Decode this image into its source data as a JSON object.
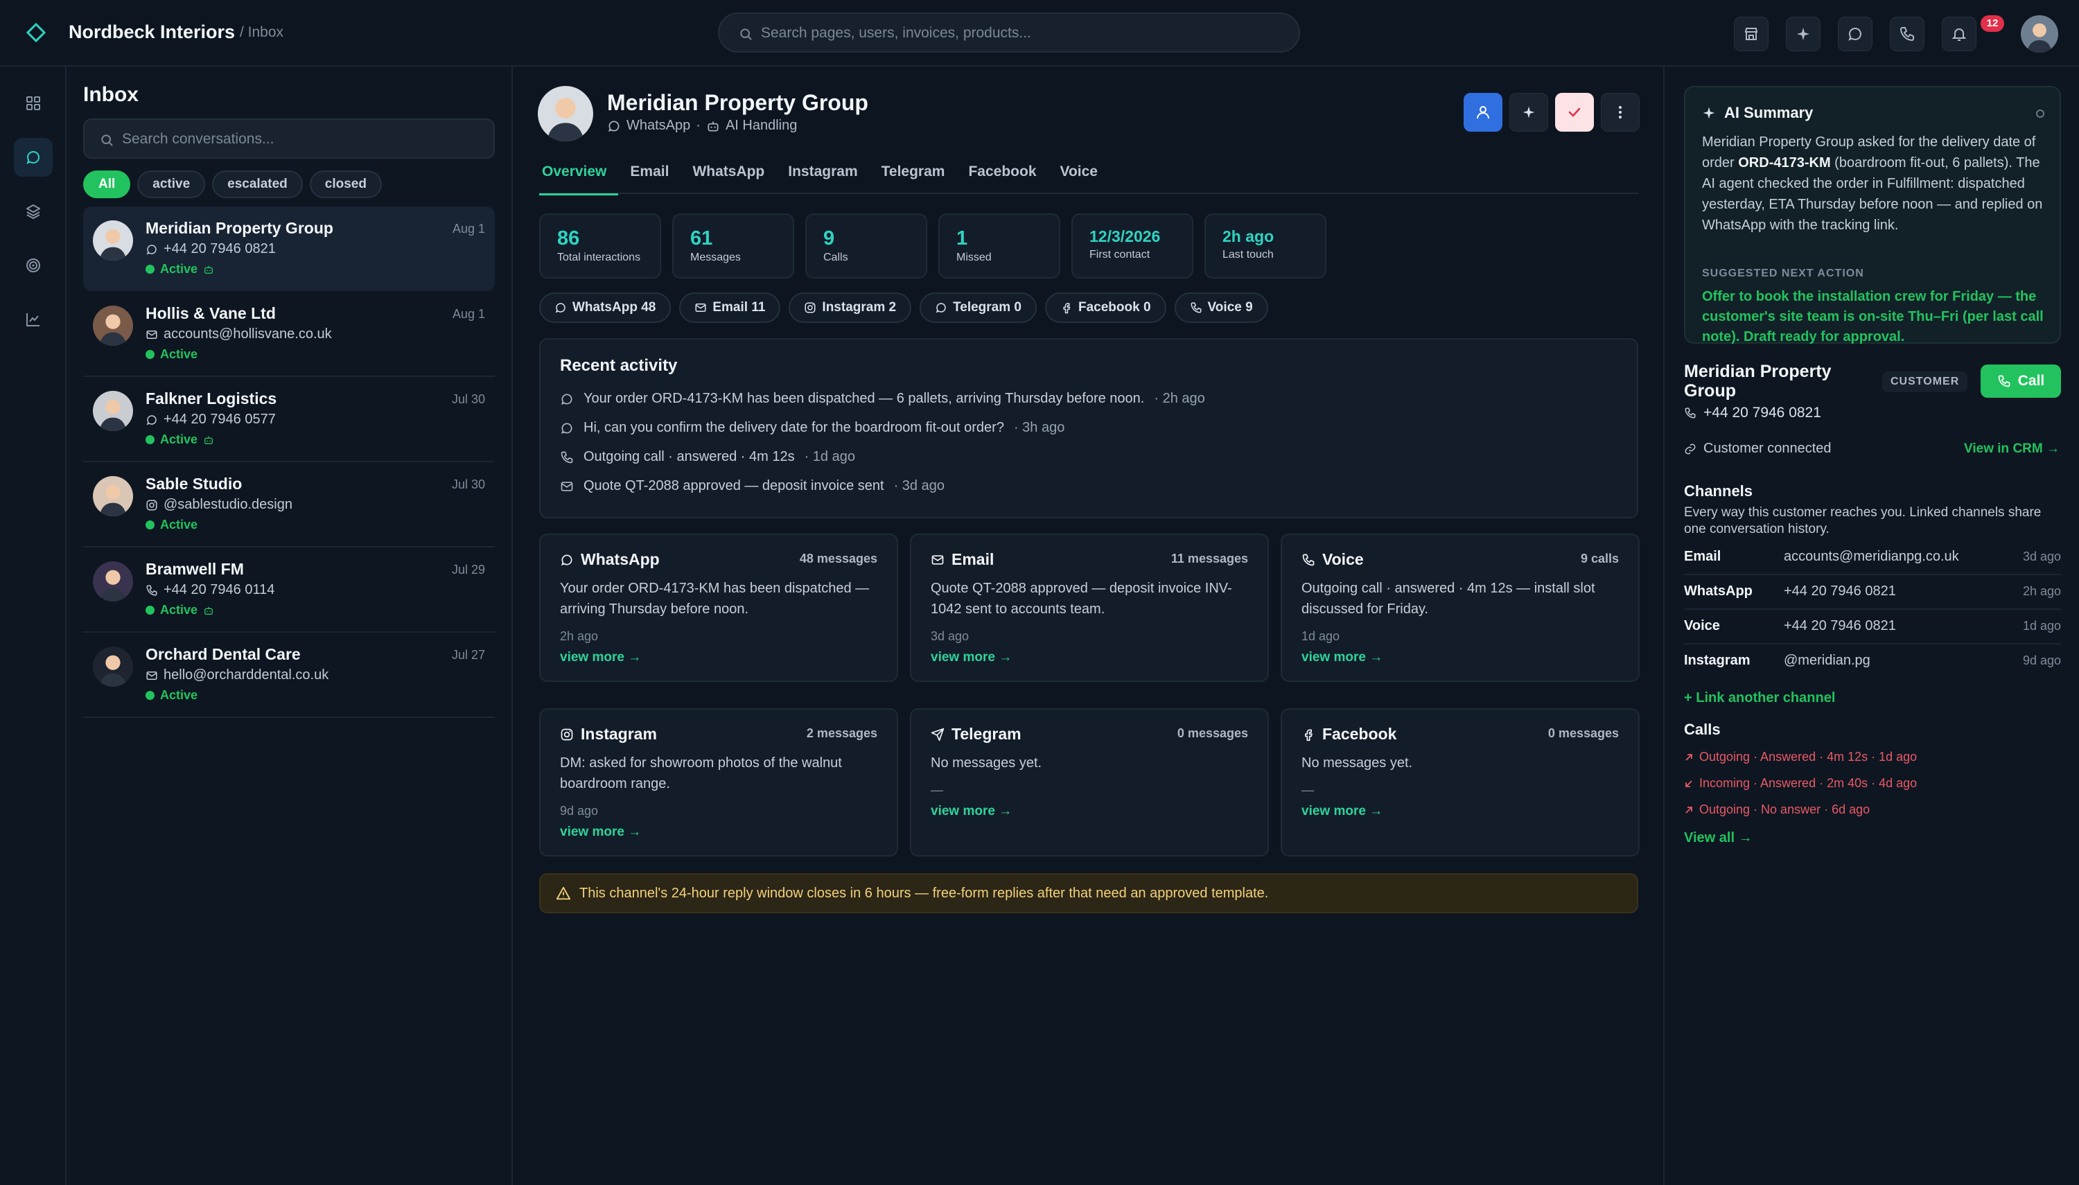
{
  "topbar": {
    "brand": "Nordbeck Interiors",
    "crumb": "/ Inbox",
    "search_placeholder": "Search pages, users, invoices, products...",
    "notifications": "12"
  },
  "inbox": {
    "title": "Inbox",
    "search_placeholder": "Search conversations...",
    "filters": [
      "All",
      "active",
      "escalated",
      "closed"
    ],
    "conversations": [
      {
        "name": "Meridian Property Group",
        "contact": "+44 20 7946 0821",
        "channel": "whatsapp",
        "status": "Active",
        "date": "Aug 1",
        "ai": true
      },
      {
        "name": "Hollis & Vane Ltd",
        "contact": "accounts@hollisvane.co.uk",
        "channel": "email",
        "status": "Active",
        "date": "Aug 1",
        "ai": false
      },
      {
        "name": "Falkner Logistics",
        "contact": "+44 20 7946 0577",
        "channel": "whatsapp",
        "status": "Active",
        "date": "Jul 30",
        "ai": true
      },
      {
        "name": "Sable Studio",
        "contact": "@sablestudio.design",
        "channel": "instagram",
        "status": "Active",
        "date": "Jul 30",
        "ai": false
      },
      {
        "name": "Bramwell FM",
        "contact": "+44 20 7946 0114",
        "channel": "voice",
        "status": "Active",
        "date": "Jul 29",
        "ai": true
      },
      {
        "name": "Orchard Dental Care",
        "contact": "hello@orcharddental.co.uk",
        "channel": "email",
        "status": "Active",
        "date": "Jul 27",
        "ai": false
      }
    ]
  },
  "contact": {
    "name": "Meridian Property Group",
    "channel": "WhatsApp",
    "separator": "·",
    "handling": "AI Handling"
  },
  "tabs": [
    "Overview",
    "Email",
    "WhatsApp",
    "Instagram",
    "Telegram",
    "Facebook",
    "Voice"
  ],
  "stats": [
    {
      "value": "86",
      "label": "Total interactions"
    },
    {
      "value": "61",
      "label": "Messages"
    },
    {
      "value": "9",
      "label": "Calls"
    },
    {
      "value": "1",
      "label": "Missed"
    },
    {
      "value": "12/3/2026",
      "label": "First contact"
    },
    {
      "value": "2h ago",
      "label": "Last touch"
    }
  ],
  "channel_pills": [
    {
      "label": "WhatsApp 48",
      "icon": "chat-icon"
    },
    {
      "label": "Email 11",
      "icon": "mail-icon"
    },
    {
      "label": "Instagram 2",
      "icon": "instagram-icon"
    },
    {
      "label": "Telegram 0",
      "icon": "chat-icon"
    },
    {
      "label": "Facebook 0",
      "icon": "facebook-icon"
    },
    {
      "label": "Voice 9",
      "icon": "phone-icon"
    }
  ],
  "recent": {
    "title": "Recent activity",
    "items": [
      {
        "text": "Your order ORD-4173-KM has been dispatched — 6 pallets, arriving Thursday before noon.",
        "time": "· 2h ago",
        "icon": "chat-icon"
      },
      {
        "text": "Hi, can you confirm the delivery date for the boardroom fit-out order?",
        "time": "· 3h ago",
        "icon": "chat-icon"
      },
      {
        "text": "Outgoing call · answered · 4m 12s",
        "time": "· 1d ago",
        "icon": "phone-icon"
      },
      {
        "text": "Quote QT-2088 approved — deposit invoice sent",
        "time": "· 3d ago",
        "icon": "mail-icon"
      }
    ]
  },
  "cards": [
    {
      "title": "WhatsApp",
      "count": "48 messages",
      "message": "Your order ORD-4173-KM has been dispatched — arriving Thursday before noon.",
      "ago": "2h ago",
      "more": "view more →",
      "icon": "chat-icon"
    },
    {
      "title": "Email",
      "count": "11 messages",
      "message": "Quote QT-2088 approved — deposit invoice INV-1042 sent to accounts team.",
      "ago": "3d ago",
      "more": "view more →",
      "icon": "mail-icon"
    },
    {
      "title": "Voice",
      "count": "9 calls",
      "message": "Outgoing call · answered · 4m 12s — install slot discussed for Friday.",
      "ago": "1d ago",
      "more": "view more →",
      "icon": "phone-icon"
    },
    {
      "title": "Instagram",
      "count": "2 messages",
      "message": "DM: asked for showroom photos of the walnut boardroom range.",
      "ago": "9d ago",
      "more": "view more →",
      "icon": "instagram-icon"
    },
    {
      "title": "Telegram",
      "count": "0 messages",
      "message": "No messages yet.",
      "ago": "—",
      "more": "view more →",
      "icon": "send-icon"
    },
    {
      "title": "Facebook",
      "count": "0 messages",
      "message": "No messages yet.",
      "ago": "—",
      "more": "view more →",
      "icon": "facebook-icon"
    }
  ],
  "warning": "This channel's 24-hour reply window closes in 6 hours — free-form replies after that need an approved template.",
  "ai_summary": {
    "title": "AI Summary",
    "body_1": "Meridian Property Group asked for the delivery date of order ",
    "order": "ORD-4173-KM",
    "body_2": " (boardroom fit-out, 6 pallets). The AI agent checked the order in Fulfillment: dispatched yesterday, ETA Thursday before noon — and replied on WhatsApp with the tracking link.",
    "next_label": "SUGGESTED NEXT ACTION",
    "next": "Offer to book the installation crew for Friday — the customer's site team is on-site Thu–Fri (per last call note). Draft ready for approval."
  },
  "customer": {
    "name": "Meridian Property Group",
    "tag": "CUSTOMER",
    "call": "Call",
    "phone": "+44 20 7946 0821",
    "connected": "Customer connected",
    "crm": "View in CRM →"
  },
  "channels": {
    "title": "Channels",
    "desc": "Every way this customer reaches you. Linked channels share one conversation history.",
    "rows": [
      {
        "key": "Email",
        "value": "accounts@meridianpg.co.uk",
        "ago": "3d ago"
      },
      {
        "key": "WhatsApp",
        "value": "+44 20 7946 0821",
        "ago": "2h ago"
      },
      {
        "key": "Voice",
        "value": "+44 20 7946 0821",
        "ago": "1d ago"
      },
      {
        "key": "Instagram",
        "value": "@meridian.pg",
        "ago": "9d ago"
      }
    ],
    "link": "+ Link another channel"
  },
  "calls": {
    "title": "Calls",
    "rows": [
      {
        "text": "Outgoing · Answered · 4m 12s · 1d ago",
        "dir": "out"
      },
      {
        "text": "Incoming · Answered · 2m 40s · 4d ago",
        "dir": "in"
      },
      {
        "text": "Outgoing · No answer · 6d ago",
        "dir": "out"
      }
    ],
    "view_all": "View all →"
  },
  "colors": {
    "accent": "#22c35e",
    "teal": "#2fd3c2",
    "badge": "#e2304a",
    "call_red": "#e75a66",
    "primary_btn": "#2f6fe0"
  }
}
